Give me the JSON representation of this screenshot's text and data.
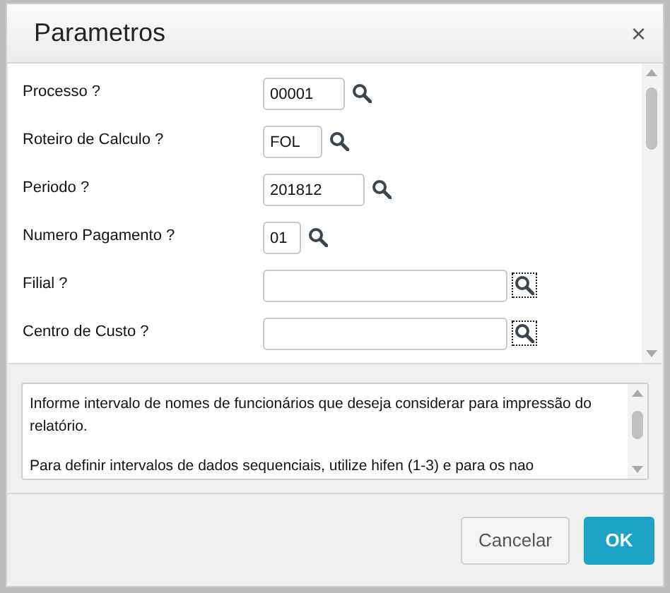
{
  "dialog": {
    "title": "Parametros",
    "close": "×"
  },
  "parameters": [
    {
      "label": "Processo ?",
      "value": "00001",
      "lookup_framed": false
    },
    {
      "label": "Roteiro de Calculo ?",
      "value": "FOL",
      "lookup_framed": false
    },
    {
      "label": "Periodo ?",
      "value": "201812",
      "lookup_framed": false
    },
    {
      "label": "Numero Pagamento ?",
      "value": "01",
      "lookup_framed": false
    },
    {
      "label": "Filial ?",
      "lookup_framed": true
    },
    {
      "label": "Centro de Custo ?",
      "lookup_framed": true
    }
  ],
  "help": [
    "Informe intervalo de nomes de funcionários que deseja considerar para impressão do relatório.",
    "Para definir intervalos de dados sequenciais, utilize hifen (1-3) e para os nao"
  ],
  "buttons": [
    {
      "label": "Cancelar",
      "kind": "secondary"
    },
    {
      "label": "OK",
      "kind": "primary"
    }
  ]
}
